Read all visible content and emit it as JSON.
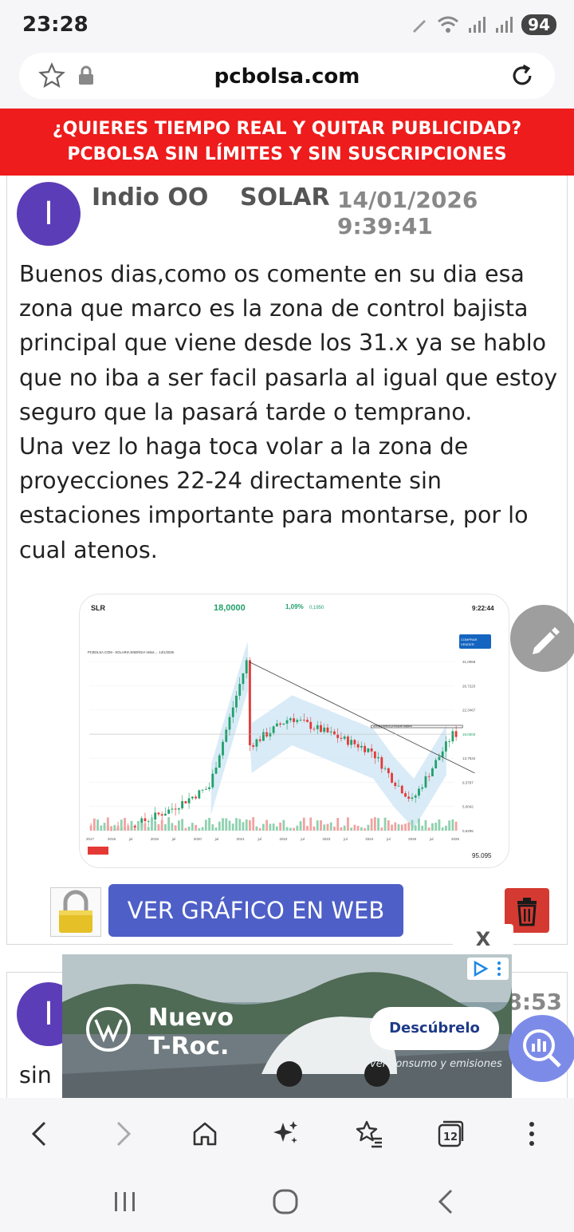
{
  "status": {
    "time": "23:28",
    "battery": "94"
  },
  "browser": {
    "url": "pcbolsa.com"
  },
  "banner": {
    "line1": "¿QUIERES TIEMPO REAL Y QUITAR PUBLICIDAD?",
    "line2": "PCBOLSA SIN LÍMITES Y SIN SUSCRIPCIONES"
  },
  "post": {
    "avatar_letter": "I",
    "author": "Indio OO",
    "ticker": "SOLAR",
    "date": "14/01/2026 9:39:41",
    "body_p1": "Buenos dias,como os comente en su dia esa zona que marco es la zona de control bajista principal que viene desde los 31.x ya se hablo que no iba a ser facil pasarla al igual que estoy seguro que la pasará tarde o temprano.",
    "body_p2": "Una vez lo haga toca volar a la zona de proyecciones 22-24 directamente sin estaciones importante para montarse, por lo cual atenos.",
    "web_button": "VER GRÁFICO EN WEB"
  },
  "chart_image": {
    "symbol": "SLR",
    "price": "18,0000",
    "change": "1,09%",
    "change_abs": "0,1950",
    "time": "9:22:44",
    "buy_button": "COMPRAR\nVENDER",
    "source_line": "PCBOLSA.COM - SOLARIA ENERGIA Velas ... 14/1/2026",
    "annotation": "Zona control principal bajista",
    "x_ticks": [
      "2017",
      "2018",
      "jul",
      "2019",
      "jul",
      "2020",
      "jul",
      "2021",
      "jul",
      "2022",
      "jul",
      "2023",
      "jul",
      "2024",
      "jul",
      "2025",
      "jul",
      "2026"
    ],
    "y_ticks": [
      "31,0968",
      "26,7223",
      "22,3467",
      "18,0000",
      "13,7534",
      "9,3787",
      "5,0042",
      "0,6295"
    ],
    "volume_label": "95.095",
    "colors": {
      "up": "#22a06b",
      "down": "#e53935",
      "band": "#cfe6f5"
    },
    "chart_data": {
      "type": "candlestick",
      "xlim": [
        "2017",
        "2026"
      ],
      "ylim": [
        0.6295,
        31.0968
      ],
      "approx_close_series": [
        {
          "x": "2017",
          "y": 1.3
        },
        {
          "x": "2018",
          "y": 1.1
        },
        {
          "x": "2019",
          "y": 4.3
        },
        {
          "x": "2020",
          "y": 8.5
        },
        {
          "x": "2020-12",
          "y": 31.1
        },
        {
          "x": "2021",
          "y": 16
        },
        {
          "x": "2022",
          "y": 21
        },
        {
          "x": "2023",
          "y": 18
        },
        {
          "x": "2024",
          "y": 15
        },
        {
          "x": "2024-07",
          "y": 10
        },
        {
          "x": "2025",
          "y": 6
        },
        {
          "x": "2026",
          "y": 18
        }
      ]
    }
  },
  "post2": {
    "avatar_letter": "I",
    "time": "8:53",
    "text": "sin"
  },
  "ad": {
    "close": "X",
    "title_line1": "Nuevo",
    "title_line2": "T-Roc.",
    "cta": "Descúbrelo",
    "small": "ver consumo y emisiones"
  },
  "toolbar": {
    "tabs_count": "12"
  }
}
